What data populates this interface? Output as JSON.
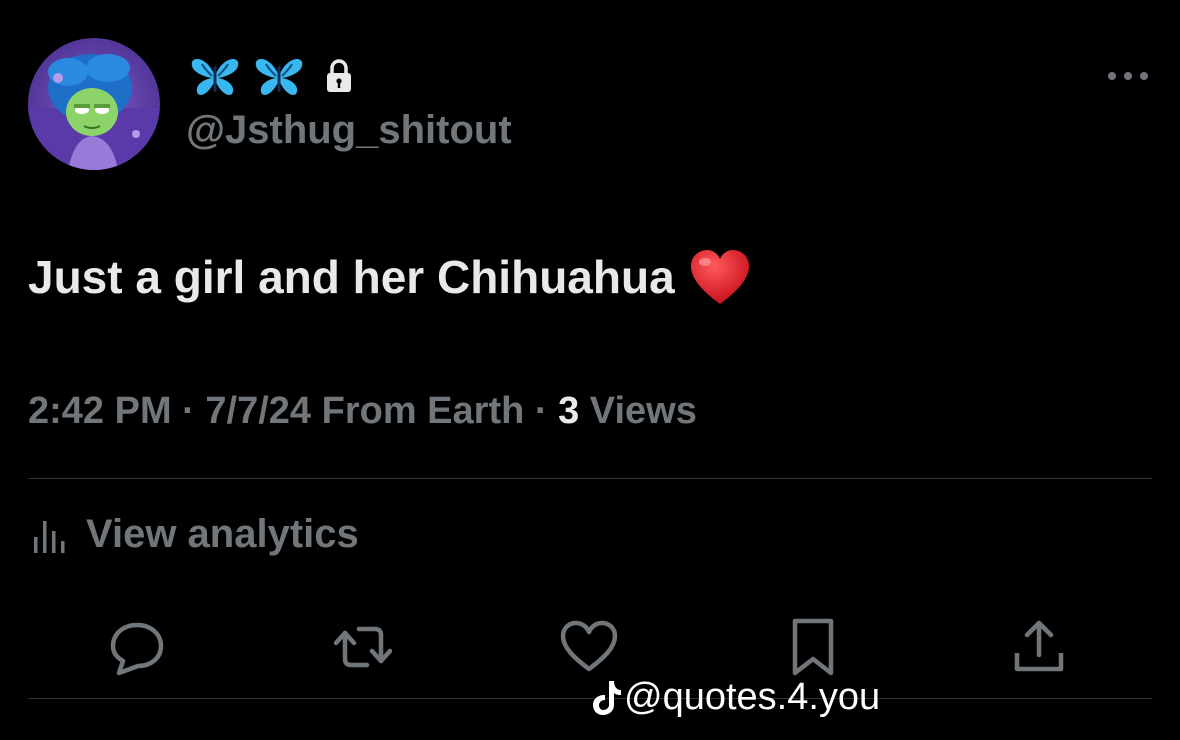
{
  "author": {
    "display_name_icons": [
      "butterfly-icon",
      "butterfly-icon",
      "lock-icon"
    ],
    "handle": "@Jsthug_shitout"
  },
  "tweet": {
    "text": "Just a girl and her Chihuahua",
    "emoji": "red-heart-emoji"
  },
  "meta": {
    "time": "2:42 PM",
    "sep1": " · ",
    "date": "7/7/24",
    "source": " From Earth",
    "sep2": " · ",
    "views_count": "3",
    "views_label": " Views"
  },
  "analytics": {
    "label": "View analytics"
  },
  "actions": [
    "reply-icon",
    "retweet-icon",
    "like-icon",
    "bookmark-icon",
    "share-icon"
  ],
  "watermark": {
    "text": "@quotes.4.you"
  },
  "colors": {
    "background": "#000000",
    "text_primary": "#e7e9ea",
    "text_secondary": "#71767b",
    "butterfly": "#39b8f0",
    "heart": "#e0202e",
    "divider": "#2f3336"
  }
}
